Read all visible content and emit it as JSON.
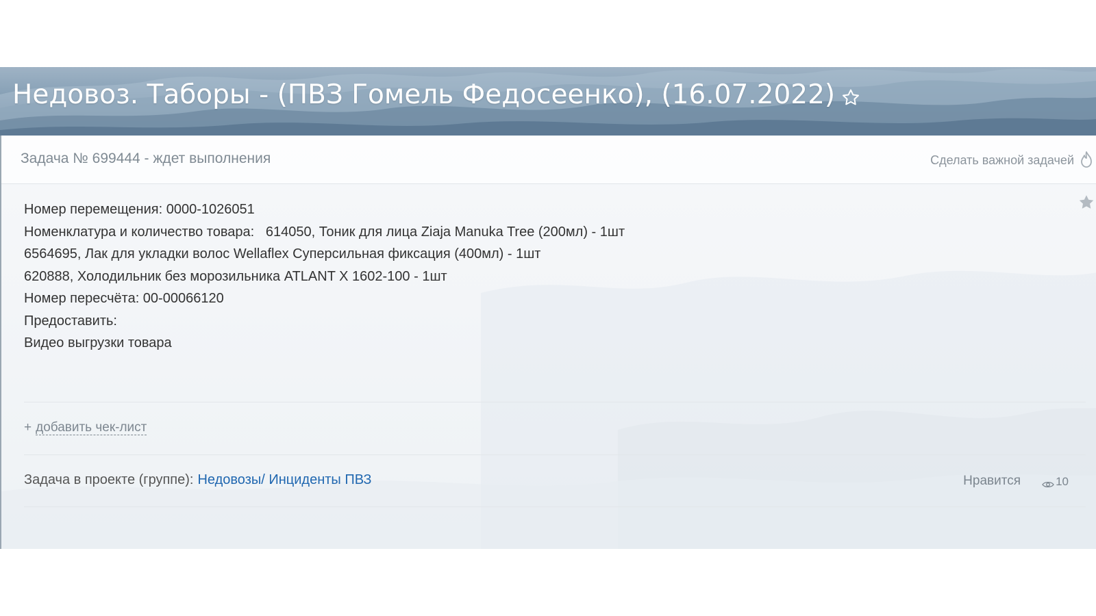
{
  "header": {
    "title": "Недовоз. Таборы - (ПВЗ Гомель Федосеенко), (16.07.2022)",
    "star_icon": "star-outline-icon"
  },
  "task": {
    "status_text": "Задача № 699444 - ждет выполнения",
    "make_important_label": "Сделать важной задачей",
    "fire_icon": "fire-icon",
    "side_star_icon": "star-icon"
  },
  "description": {
    "lines": [
      "Номер перемещения: 0000-1026051",
      "Номенклатура и количество товара:   614050, Тоник для лица Ziaja Manuka Tree (200мл) - 1шт",
      "6564695, Лак для укладки волос Wellaflex Суперсильная фиксация (400мл) - 1шт",
      "620888, Холодильник без морозильника ATLANT Х 1602-100 - 1шт",
      "Номер пересчёта: 00-00066120",
      "Предоставить:",
      "Видео выгрузки товара"
    ]
  },
  "checklist": {
    "plus": "+",
    "add_label": "добавить чек-лист"
  },
  "project": {
    "label": "Задача в проекте (группе):",
    "link": "Недовозы/ Инциденты ПВЗ"
  },
  "footer": {
    "like_label": "Нравится",
    "views_count": "10",
    "eye_icon": "eye-icon"
  },
  "colors": {
    "link": "#2067b0",
    "muted": "#7f8a93",
    "header_bg": "#7f98ae"
  }
}
